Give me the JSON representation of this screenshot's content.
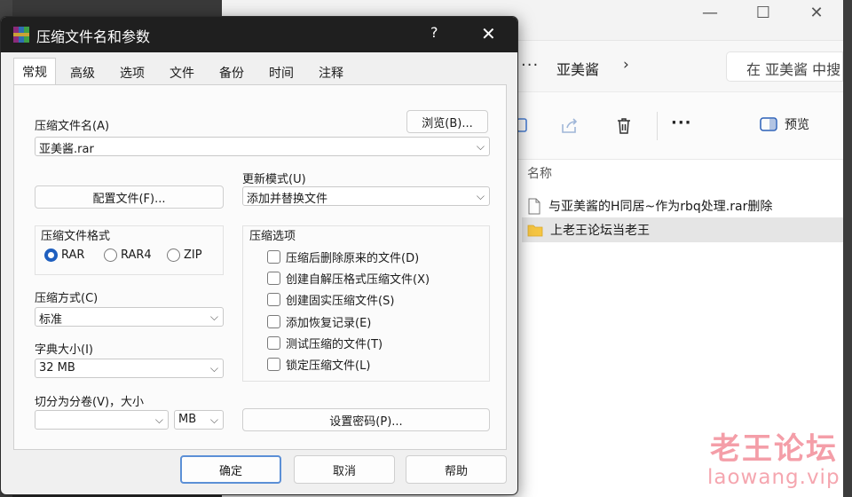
{
  "colors": {
    "titlebar_bg": "#1f1f1f",
    "dialog_bg": "#f0f0f0",
    "accent": "#1f5fbf",
    "folder_yellow": "#f5c542",
    "watermark": "#eb4e60"
  },
  "dialog": {
    "title": "压缩文件名和参数",
    "help_glyph": "?",
    "close_glyph": "✕",
    "tabs": [
      {
        "label": "常规",
        "active": true
      },
      {
        "label": "高级"
      },
      {
        "label": "选项"
      },
      {
        "label": "文件"
      },
      {
        "label": "备份"
      },
      {
        "label": "时间"
      },
      {
        "label": "注释"
      }
    ],
    "archive_name_label": "压缩文件名(A)",
    "browse_button": "浏览(B)...",
    "archive_name_value": "亚美酱.rar",
    "profiles_button": "配置文件(F)...",
    "update_mode_label": "更新模式(U)",
    "update_mode_value": "添加并替换文件",
    "format_group_label": "压缩文件格式",
    "formats": [
      {
        "label": "RAR",
        "selected": true
      },
      {
        "label": "RAR4",
        "selected": false
      },
      {
        "label": "ZIP",
        "selected": false
      }
    ],
    "options_group_label": "压缩选项",
    "options": [
      {
        "label": "压缩后删除原来的文件(D)",
        "checked": false
      },
      {
        "label": "创建自解压格式压缩文件(X)",
        "checked": false
      },
      {
        "label": "创建固实压缩文件(S)",
        "checked": false
      },
      {
        "label": "添加恢复记录(E)",
        "checked": false
      },
      {
        "label": "测试压缩的文件(T)",
        "checked": false
      },
      {
        "label": "锁定压缩文件(L)",
        "checked": false
      }
    ],
    "method_label": "压缩方式(C)",
    "method_value": "标准",
    "dict_label": "字典大小(I)",
    "dict_value": "32 MB",
    "split_label": "切分为分卷(V)，大小",
    "split_value": "",
    "split_unit": "MB",
    "password_button": "设置密码(P)...",
    "ok_button": "确定",
    "cancel_button": "取消",
    "help_button": "帮助"
  },
  "explorer": {
    "minimize_glyph": "—",
    "maximize_glyph": "☐",
    "close_glyph": "✕",
    "more_glyph": "···",
    "breadcrumb": "亚美酱",
    "breadcrumb_chevron": "›",
    "search_placeholder": "在 亚美酱 中搜",
    "toolbar_more": "···",
    "preview_label": "预览",
    "column_name": "名称",
    "files": [
      {
        "name": "与亚美酱的H同居~作为rbq处理.rar删除",
        "icon": "file-icon"
      },
      {
        "name": "上老王论坛当老王",
        "icon": "folder-icon",
        "selected": true
      }
    ]
  },
  "watermark": {
    "cn": "老王论坛",
    "en": "laowang.vip"
  }
}
